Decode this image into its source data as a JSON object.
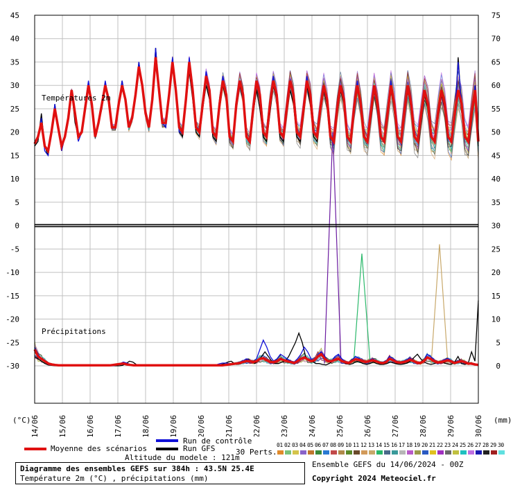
{
  "chart_data": {
    "type": "line",
    "title": "Diagramme des ensembles GEFS sur 384h : 43.5N 25.4E",
    "subtitle": "Température 2m (°C) , précipitations (mm)",
    "panel_labels": {
      "temperature": "Températures 2m",
      "precipitation": "Précipitations"
    },
    "left_axis_unit": "(°C)",
    "right_axis_unit": "(mm)",
    "left_ticks": [
      45,
      40,
      35,
      30,
      25,
      20,
      15,
      10,
      5,
      0,
      -5,
      -10,
      -15,
      -20,
      -25,
      -30
    ],
    "right_ticks": [
      75,
      70,
      65,
      60,
      55,
      50,
      45,
      40,
      35,
      30,
      25,
      20,
      15,
      10,
      5,
      0
    ],
    "ylim": [
      -38,
      45
    ],
    "x_labels": [
      "14/06",
      "15/06",
      "16/06",
      "17/06",
      "18/06",
      "19/06",
      "20/06",
      "21/06",
      "22/06",
      "23/06",
      "24/06",
      "25/06",
      "26/06",
      "27/06",
      "28/06",
      "29/06",
      "30/06"
    ],
    "grid": true,
    "mean_temperature": [
      17.5,
      19,
      22,
      17,
      16,
      20,
      25,
      21,
      17,
      19,
      23,
      29,
      24,
      19,
      20,
      25,
      30,
      26,
      19,
      22,
      26,
      30,
      27,
      21,
      21,
      26,
      30,
      27,
      21,
      23,
      28,
      34,
      30,
      24,
      21,
      27,
      36,
      29,
      22,
      22,
      28,
      35,
      29,
      21,
      20,
      27,
      35,
      29,
      21,
      20,
      26,
      32,
      29,
      20,
      19,
      26,
      31,
      28,
      19,
      18,
      26,
      31,
      28,
      19,
      18,
      25,
      31,
      28,
      20,
      19,
      26,
      31,
      28,
      20,
      19,
      25,
      31,
      28,
      20,
      19,
      25,
      31,
      28,
      20,
      19,
      25,
      30,
      27,
      19,
      18,
      25,
      30,
      27,
      19,
      18,
      25,
      30,
      26,
      19,
      18,
      24,
      30,
      26,
      19,
      18,
      24,
      30,
      26,
      19,
      18,
      24,
      30,
      26,
      19,
      18,
      24,
      29,
      26,
      19,
      18,
      24,
      29,
      26,
      19,
      18,
      24,
      29,
      26,
      19,
      18,
      24,
      29,
      18
    ],
    "control_temperature": [
      18,
      19,
      23,
      16,
      15,
      20,
      26,
      21,
      16,
      19,
      23,
      29,
      23,
      18,
      20,
      26,
      31,
      26,
      19,
      22,
      26,
      31,
      27,
      21,
      21,
      26,
      31,
      27,
      21,
      23,
      28,
      35,
      30,
      24,
      21,
      27,
      38,
      29,
      22,
      21,
      28,
      36,
      29,
      20,
      20,
      27,
      36,
      29,
      21,
      20,
      26,
      33,
      29,
      20,
      19,
      26,
      32,
      28,
      19,
      18,
      26,
      31,
      28,
      19,
      18,
      25,
      31,
      27,
      20,
      19,
      26,
      32,
      28,
      20,
      19,
      25,
      31,
      27,
      20,
      19,
      25,
      32,
      28,
      20,
      19,
      25,
      30,
      27,
      19,
      18,
      25,
      30,
      27,
      19,
      18,
      25,
      31,
      26,
      19,
      18,
      24,
      30,
      26,
      19,
      18,
      24,
      31,
      26,
      19,
      18,
      24,
      30,
      26,
      19,
      18,
      24,
      29,
      26,
      19,
      18,
      24,
      29,
      26,
      19,
      18,
      24,
      35,
      26,
      19,
      18,
      24,
      30,
      18
    ],
    "gfs_temperature": [
      17,
      18,
      24,
      17,
      15,
      20,
      26,
      21,
      16,
      19,
      23,
      29,
      22,
      19,
      20,
      25,
      30,
      25,
      19,
      22,
      25,
      30,
      26,
      21,
      21,
      26,
      31,
      27,
      21,
      23,
      28,
      35,
      30,
      24,
      21,
      27,
      38,
      29,
      22,
      21,
      28,
      35,
      28,
      20,
      19,
      26,
      33,
      27,
      20,
      19,
      25,
      30,
      27,
      19,
      18,
      25,
      30,
      27,
      19,
      18,
      25,
      30,
      27,
      19,
      18,
      24,
      29,
      25,
      19,
      18,
      24,
      30,
      27,
      19,
      18,
      24,
      29,
      26,
      19,
      18,
      24,
      30,
      26,
      19,
      18,
      24,
      29,
      26,
      19,
      18,
      24,
      29,
      26,
      19,
      18,
      24,
      30,
      25,
      19,
      18,
      23,
      29,
      25,
      19,
      18,
      23,
      30,
      25,
      19,
      18,
      23,
      29,
      25,
      19,
      18,
      23,
      28,
      25,
      19,
      18,
      23,
      28,
      25,
      19,
      18,
      23,
      36,
      25,
      19,
      18,
      24,
      30,
      17
    ],
    "mean_precip": [
      3.5,
      2,
      1.5,
      1,
      0.5,
      0.3,
      0.2,
      0.1,
      0.1,
      0.1,
      0.1,
      0.1,
      0.1,
      0.1,
      0.1,
      0.1,
      0.1,
      0.1,
      0.1,
      0.1,
      0.1,
      0.1,
      0.1,
      0.2,
      0.3,
      0.4,
      0.5,
      0.3,
      0.2,
      0.1,
      0.1,
      0.1,
      0.1,
      0.1,
      0.1,
      0.1,
      0.1,
      0.1,
      0.1,
      0.1,
      0.1,
      0.1,
      0.1,
      0.1,
      0.1,
      0.1,
      0.1,
      0.1,
      0.1,
      0.1,
      0.1,
      0.1,
      0.1,
      0.1,
      0.1,
      0.1,
      0.2,
      0.3,
      0.4,
      0.5,
      0.6,
      0.8,
      1,
      1,
      0.8,
      1,
      1.5,
      1.6,
      1.2,
      0.8,
      0.8,
      1,
      1.5,
      1.2,
      1,
      0.8,
      0.6,
      1,
      1.5,
      1.8,
      1.4,
      1,
      1.2,
      2,
      2.5,
      1.5,
      1,
      1,
      1.3,
      1.5,
      1,
      0.8,
      0.6,
      1,
      1.4,
      1.3,
      1,
      0.8,
      1,
      1.2,
      1,
      0.7,
      0.6,
      0.8,
      1.5,
      1.2,
      0.8,
      0.7,
      0.8,
      1,
      1.3,
      1,
      0.7,
      0.6,
      1,
      1.8,
      1.5,
      1,
      0.7,
      0.8,
      1,
      1.2,
      1,
      0.6,
      0.8,
      1,
      0.8,
      0.5,
      0.5,
      0.3,
      0.2
    ],
    "control_precip": [
      4,
      2.5,
      1.5,
      0.8,
      0.3,
      0.2,
      0.1,
      0,
      0,
      0,
      0,
      0,
      0,
      0,
      0,
      0,
      0,
      0,
      0,
      0,
      0,
      0,
      0,
      0,
      0.2,
      0.5,
      0.8,
      0.6,
      0.3,
      0.2,
      0.1,
      0,
      0,
      0,
      0,
      0,
      0,
      0,
      0,
      0,
      0,
      0,
      0,
      0,
      0,
      0,
      0,
      0,
      0,
      0,
      0,
      0,
      0,
      0.2,
      0.4,
      0.6,
      0.6,
      0.5,
      0.5,
      0.6,
      0.8,
      1,
      1.5,
      1.2,
      0.8,
      1.5,
      3.5,
      5.5,
      4,
      2,
      1,
      1.5,
      2.5,
      2,
      1.5,
      1,
      0.8,
      1.5,
      2.5,
      4,
      3,
      1.5,
      1,
      2.5,
      3,
      2,
      1,
      1,
      2,
      2.5,
      1.5,
      1,
      0.7,
      1.3,
      2,
      1.6,
      1,
      0.8,
      1.2,
      1.5,
      1.2,
      0.8,
      0.7,
      1,
      2,
      1.6,
      1,
      0.8,
      1,
      1.3,
      1.6,
      1.2,
      0.8,
      0.7,
      1.2,
      2.5,
      2,
      1.2,
      0.8,
      1,
      1.3,
      1.6,
      1.2,
      0.7,
      1,
      1.2,
      1,
      0.6,
      0.5,
      0.4,
      0.2
    ],
    "gfs_precip": [
      2,
      1.5,
      1,
      0.5,
      0.2,
      0.1,
      0,
      0,
      0,
      0,
      0,
      0,
      0,
      0,
      0,
      0,
      0,
      0,
      0,
      0,
      0,
      0,
      0,
      0,
      0,
      0,
      0.1,
      0.5,
      1,
      0.8,
      0.3,
      0.1,
      0,
      0,
      0,
      0,
      0,
      0,
      0,
      0,
      0,
      0,
      0,
      0,
      0,
      0,
      0,
      0,
      0,
      0,
      0,
      0,
      0,
      0.1,
      0.2,
      0.3,
      0.5,
      0.8,
      1,
      0.5,
      0.3,
      0.5,
      1,
      1.5,
      1,
      0.5,
      1,
      2,
      3,
      2,
      1,
      0.5,
      0.5,
      0.8,
      1,
      2,
      3.5,
      5,
      7,
      5,
      2,
      1,
      1,
      0.5,
      0.5,
      0.3,
      0.2,
      0.5,
      1,
      1.5,
      1.2,
      0.8,
      0.5,
      0.3,
      0.5,
      1,
      0.8,
      0.5,
      0.3,
      0.5,
      0.8,
      0.5,
      0.3,
      0.3,
      0.5,
      0.8,
      0.6,
      0.4,
      0.3,
      0.4,
      0.6,
      1,
      1.8,
      2.5,
      1.5,
      0.8,
      0.5,
      0.3,
      0.5,
      0.8,
      1,
      0.6,
      0.4,
      0.3,
      0.8,
      2,
      0.5,
      0.3,
      0.5,
      3,
      1,
      14
    ],
    "peak_precip_annotations": {
      "purple_peak_mm": 50,
      "green_peak_mm": 24,
      "khaki_peak_mm": 26
    }
  },
  "legend": {
    "mean_label": "Moyenne des scénarios",
    "control_label": "Run de contrôle",
    "gfs_label": "Run GFS",
    "perts_label": "30 Perts.",
    "pert_numbers": [
      "01",
      "02",
      "03",
      "04",
      "05",
      "06",
      "07",
      "08",
      "09",
      "10",
      "11",
      "12",
      "13",
      "14",
      "15",
      "16",
      "17",
      "18",
      "19",
      "20",
      "21",
      "22",
      "23",
      "24",
      "25",
      "26",
      "27",
      "28",
      "29",
      "30"
    ],
    "pert_colors": [
      "#e08a2a",
      "#7ac27a",
      "#d4c44a",
      "#8a63c9",
      "#c0762e",
      "#3a8a3a",
      "#2a7ad2",
      "#c24a4a",
      "#b08a4a",
      "#5a8a2a",
      "#6a4a2a",
      "#d29a5a",
      "#c8a86a",
      "#2ab86a",
      "#4a6a8a",
      "#3a9a9a",
      "#b6b6b6",
      "#b85ac8",
      "#9a9a4a",
      "#2a5ac2",
      "#e0c020",
      "#a030c0",
      "#6a6a6a",
      "#c0c040",
      "#20c0c0",
      "#c070e0",
      "#1a1ab0",
      "#202020",
      "#a02020",
      "#60e0e0"
    ],
    "colors": {
      "mean": "#e01010",
      "control": "#1010d8",
      "gfs": "#000000"
    }
  },
  "footer": {
    "altitude": "Altitude du modele : 121m",
    "run_info": "Ensemble GEFS du 14/06/2024 - 00Z",
    "copyright": "Copyright 2024 Meteociel.fr"
  }
}
